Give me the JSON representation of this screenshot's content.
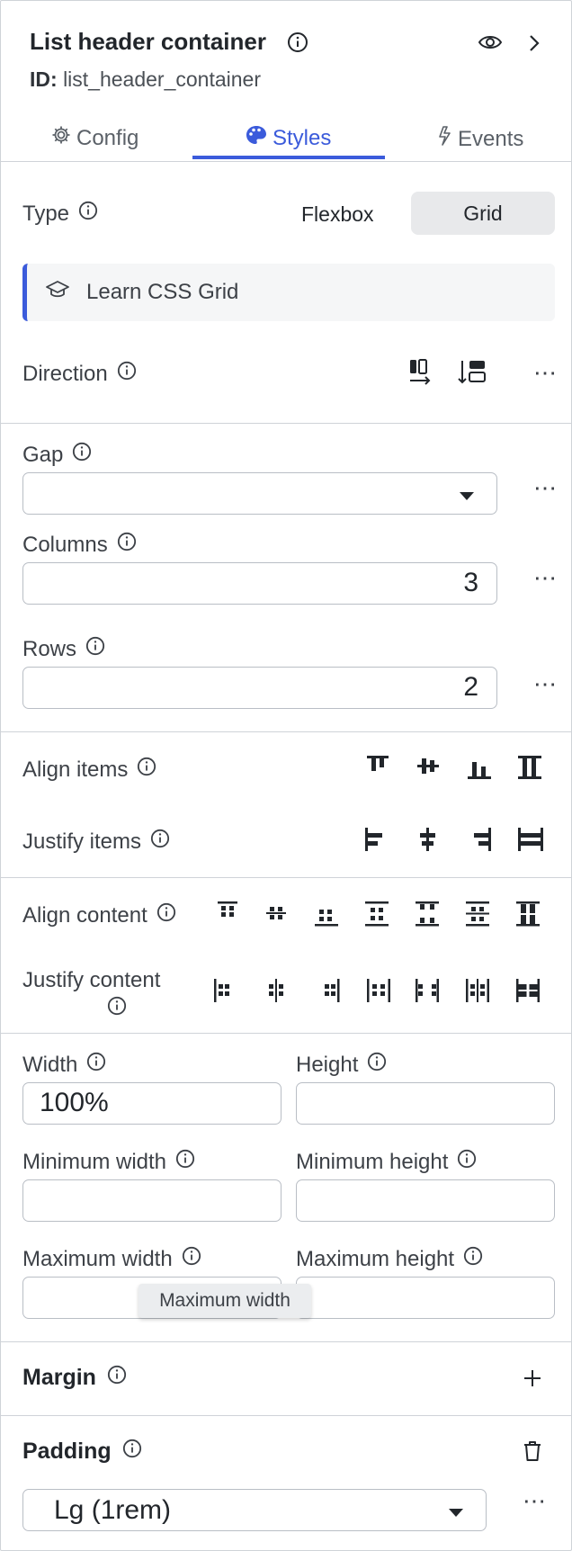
{
  "header": {
    "title": "List header container",
    "id_label": "ID:",
    "id_value": "list_header_container"
  },
  "tabs": [
    {
      "label": "Config",
      "icon": "gear-icon",
      "active": false
    },
    {
      "label": "Styles",
      "icon": "palette-icon",
      "active": true
    },
    {
      "label": "Events",
      "icon": "bolt-icon",
      "active": false
    }
  ],
  "layout": {
    "type_label": "Type",
    "type_options": [
      "Flexbox",
      "Grid"
    ],
    "type_selected": "Grid",
    "learn_link": "Learn CSS Grid",
    "direction_label": "Direction"
  },
  "grid": {
    "gap_label": "Gap",
    "gap_value": "",
    "columns_label": "Columns",
    "columns_value": "3",
    "rows_label": "Rows",
    "rows_value": "2"
  },
  "alignment": {
    "align_items_label": "Align items",
    "justify_items_label": "Justify items",
    "align_content_label": "Align content",
    "justify_content_label": "Justify content"
  },
  "size": {
    "width_label": "Width",
    "width_value": "100%",
    "height_label": "Height",
    "height_value": "",
    "min_width_label": "Minimum width",
    "min_height_label": "Minimum height",
    "max_width_label": "Maximum width",
    "max_height_label": "Maximum height",
    "tooltip": "Maximum width"
  },
  "margin": {
    "label": "Margin"
  },
  "padding": {
    "label": "Padding",
    "value": "Lg (1rem)"
  },
  "colors": {
    "accent": "#3b5bdb",
    "border": "#cfd3d8",
    "text": "#2f3338"
  }
}
